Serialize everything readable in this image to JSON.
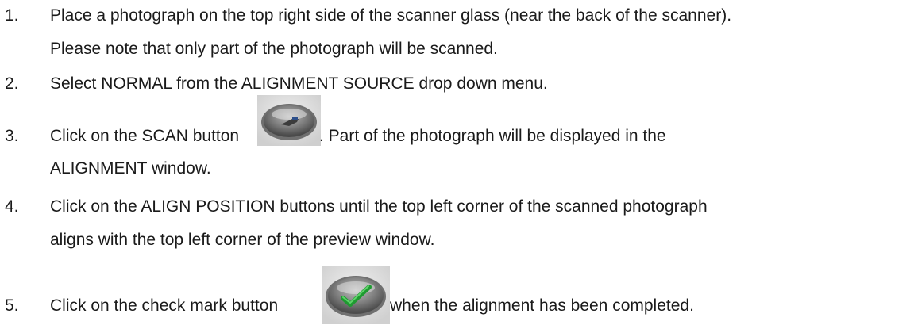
{
  "steps": [
    {
      "number": "1.",
      "lines": [
        "Place a photograph on the top right side of the scanner glass (near the back of the scanner).",
        "Please note that only part of the photograph will be scanned."
      ]
    },
    {
      "number": "2.",
      "lines": [
        "Select NORMAL from the ALIGNMENT SOURCE drop down menu."
      ]
    },
    {
      "number": "3.",
      "before_icon": "Click on the SCAN button",
      "after_icon": ".  Part of the photograph will be displayed in the",
      "continuation": "ALIGNMENT window.",
      "icon": "scan-button-icon"
    },
    {
      "number": "4.",
      "lines": [
        "Click on the ALIGN POSITION buttons until the top left corner of the scanned photograph",
        "aligns with the top left corner of the preview window."
      ]
    },
    {
      "number": "5.",
      "before_icon": "Click on the check mark button",
      "after_icon": "when the alignment has been completed.",
      "icon": "check-mark-button-icon"
    }
  ],
  "colors": {
    "text": "#1a1a1a",
    "button_gray": "#8c8c8c",
    "check_green": "#22a033"
  }
}
